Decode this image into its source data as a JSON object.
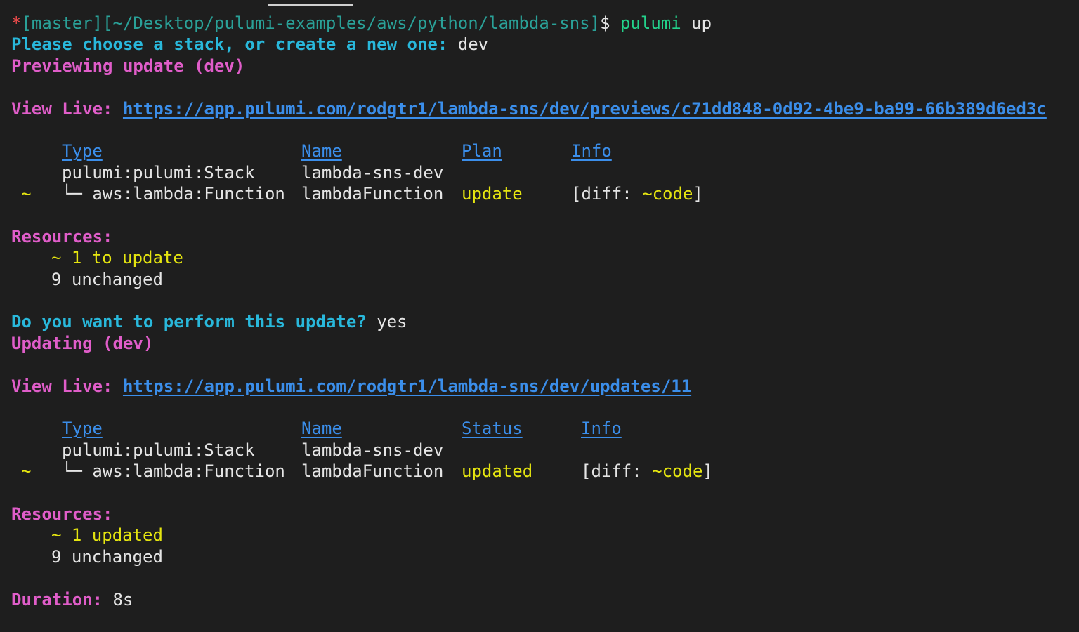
{
  "prompt": {
    "star": "*",
    "branch": "[master]",
    "path": "[~/Desktop/pulumi-examples/aws/python/lambda-sns]",
    "dollar": "$",
    "cmd": "pulumi",
    "arg": "up"
  },
  "choose_stack": {
    "label": "Please choose a stack, or create a new one:",
    "value": "dev"
  },
  "preview_header": "Previewing update (dev)",
  "preview_view_live": {
    "label": "View Live:",
    "url": "https://app.pulumi.com/rodgtr1/lambda-sns/dev/previews/c71dd848-0d92-4be9-ba99-66b389d6ed3c"
  },
  "preview_table": {
    "headers": {
      "type": "Type",
      "name": "Name",
      "plan": "Plan",
      "info": "Info"
    },
    "rows": [
      {
        "marker": "",
        "type": "pulumi:pulumi:Stack",
        "name": "lambda-sns-dev",
        "plan": "",
        "info_prefix": "",
        "info_value": "",
        "info_suffix": ""
      },
      {
        "marker": "~",
        "type": "└─ aws:lambda:Function",
        "name": "lambdaFunction",
        "plan": "update",
        "info_prefix": "[diff: ",
        "info_value": "~code",
        "info_suffix": "]"
      }
    ]
  },
  "preview_resources": {
    "label": "Resources:",
    "change": "~ 1 to update",
    "unchanged": "9 unchanged"
  },
  "confirm": {
    "label": "Do you want to perform this update?",
    "value": "yes"
  },
  "update_header": "Updating (dev)",
  "update_view_live": {
    "label": "View Live:",
    "url": "https://app.pulumi.com/rodgtr1/lambda-sns/dev/updates/11"
  },
  "update_table": {
    "headers": {
      "type": "Type",
      "name": "Name",
      "status": "Status",
      "info": "Info"
    },
    "rows": [
      {
        "marker": "",
        "type": "pulumi:pulumi:Stack",
        "name": "lambda-sns-dev",
        "status": "",
        "info_prefix": "",
        "info_value": "",
        "info_suffix": ""
      },
      {
        "marker": "~",
        "type": "└─ aws:lambda:Function",
        "name": "lambdaFunction",
        "status": "updated",
        "info_prefix": "[diff: ",
        "info_value": "~code",
        "info_suffix": "]"
      }
    ]
  },
  "update_resources": {
    "label": "Resources:",
    "change": "~ 1 updated",
    "unchanged": "9 unchanged"
  },
  "duration": {
    "label": "Duration:",
    "value": "8s"
  }
}
